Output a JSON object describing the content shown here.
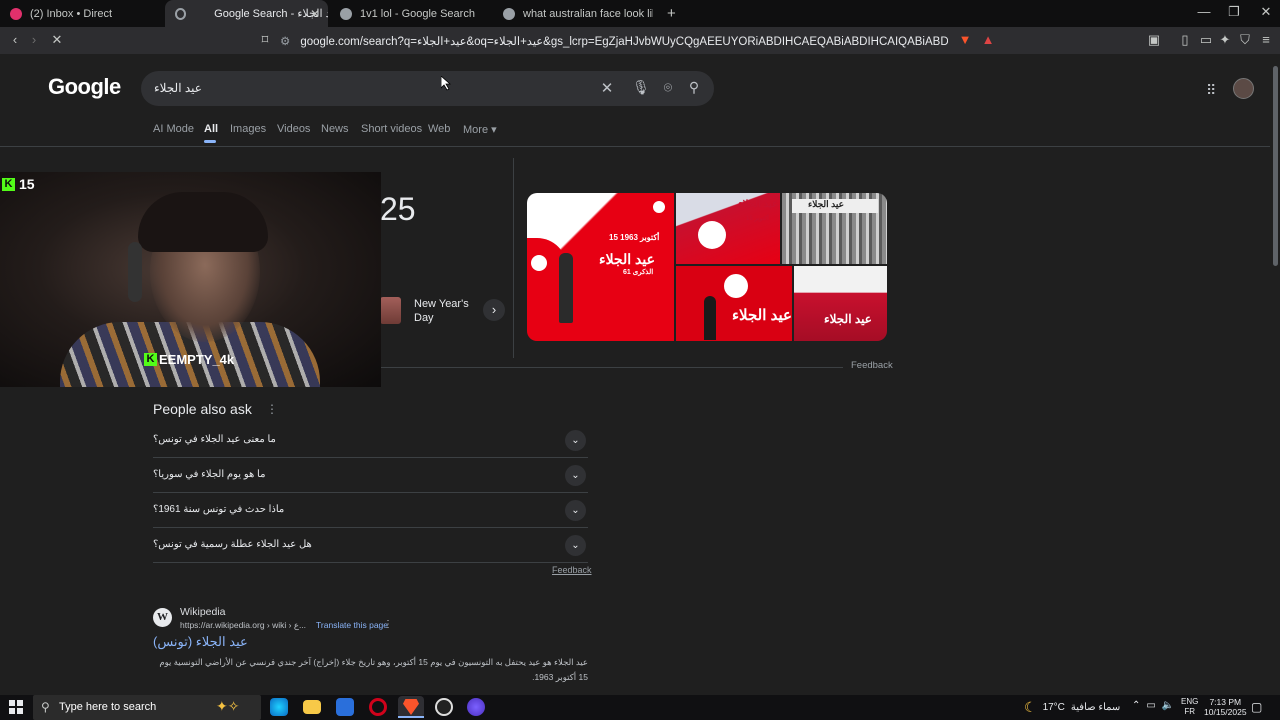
{
  "browser": {
    "tabs": [
      {
        "label": "(2) Inbox • Direct",
        "favicon_color": "#e1306c"
      },
      {
        "label": "Google Search - عيد الجلاء",
        "favicon_color": "#9aa0a6",
        "active": true
      },
      {
        "label": "1v1 lol - Google Search",
        "favicon_color": "#9aa0a6"
      },
      {
        "label": "what australian face look like - Google",
        "favicon_color": "#9aa0a6"
      }
    ],
    "new_tab_symbol": "+",
    "url": "google.com/search?q=عيد+الجلاء&oq=عيد+الجلاء&gs_lcrp=EgZjaHJvbWUyCQgAEEUYORiABDIHCAEQABiABDIHCAIQABiABDIHCAMQABiABDIICAQQABg..."
  },
  "google": {
    "logo": "Google",
    "query": "عيد الجلاء",
    "nav_tabs": [
      "AI Mode",
      "All",
      "Images",
      "Videos",
      "News",
      "Short videos",
      "Web",
      "More"
    ],
    "more_arrow": "▾"
  },
  "overlay": {
    "viewer_count": "15",
    "streamer_name": "EEMPTY_4k",
    "k_letter": "K"
  },
  "knowledge_panel": {
    "year_fragment": "25",
    "related_holiday": "New Year's Day",
    "images": [
      {
        "caption": "عيد الجلاء",
        "subcaption": "15 أكتوبر 1963",
        "note": "الذكرى 61"
      },
      {
        "caption": "عيد الجلاء",
        "subcaption": "15 أكتوبر"
      },
      {
        "caption": "عيد الجلاء"
      },
      {
        "caption": "عيد الجلاء"
      },
      {
        "caption": "عيد الجلاء"
      }
    ],
    "feedback": "Feedback"
  },
  "people_also_ask": {
    "title": "People also ask",
    "questions": [
      "ما معنى عيد الجلاء في تونس؟",
      "ما هو يوم الجلاء في سوريا؟",
      "ماذا حدث في تونس سنة 1961؟",
      "هل عيد الجلاء عطلة رسمية في تونس؟"
    ],
    "feedback": "Feedback"
  },
  "result": {
    "site_name": "Wikipedia",
    "url": "https://ar.wikipedia.org › wiki › ع...",
    "translate": "Translate this page",
    "title": "عيد الجلاء (تونس)",
    "snippet": "عيد الجلاء هو عيد يحتفل به التونسيون في يوم 15 أكتوبر، وهو تاريخ جلاء (إخراج) آخر جندي فرنسي عن الأراضي التونسية يوم 15 أكتوبر 1963."
  },
  "taskbar": {
    "search_placeholder": "Type here to search",
    "weather_temp": "17°C",
    "weather_desc": "سماء صافية",
    "lang_primary": "ENG",
    "lang_secondary": "FR",
    "time": "7:13 PM",
    "date": "10/15/2025"
  },
  "colors": {
    "page_bg": "#1f1f1f",
    "link": "#8ab4f8",
    "kick_green": "#53fc18",
    "tunisia_red": "#e70013"
  }
}
